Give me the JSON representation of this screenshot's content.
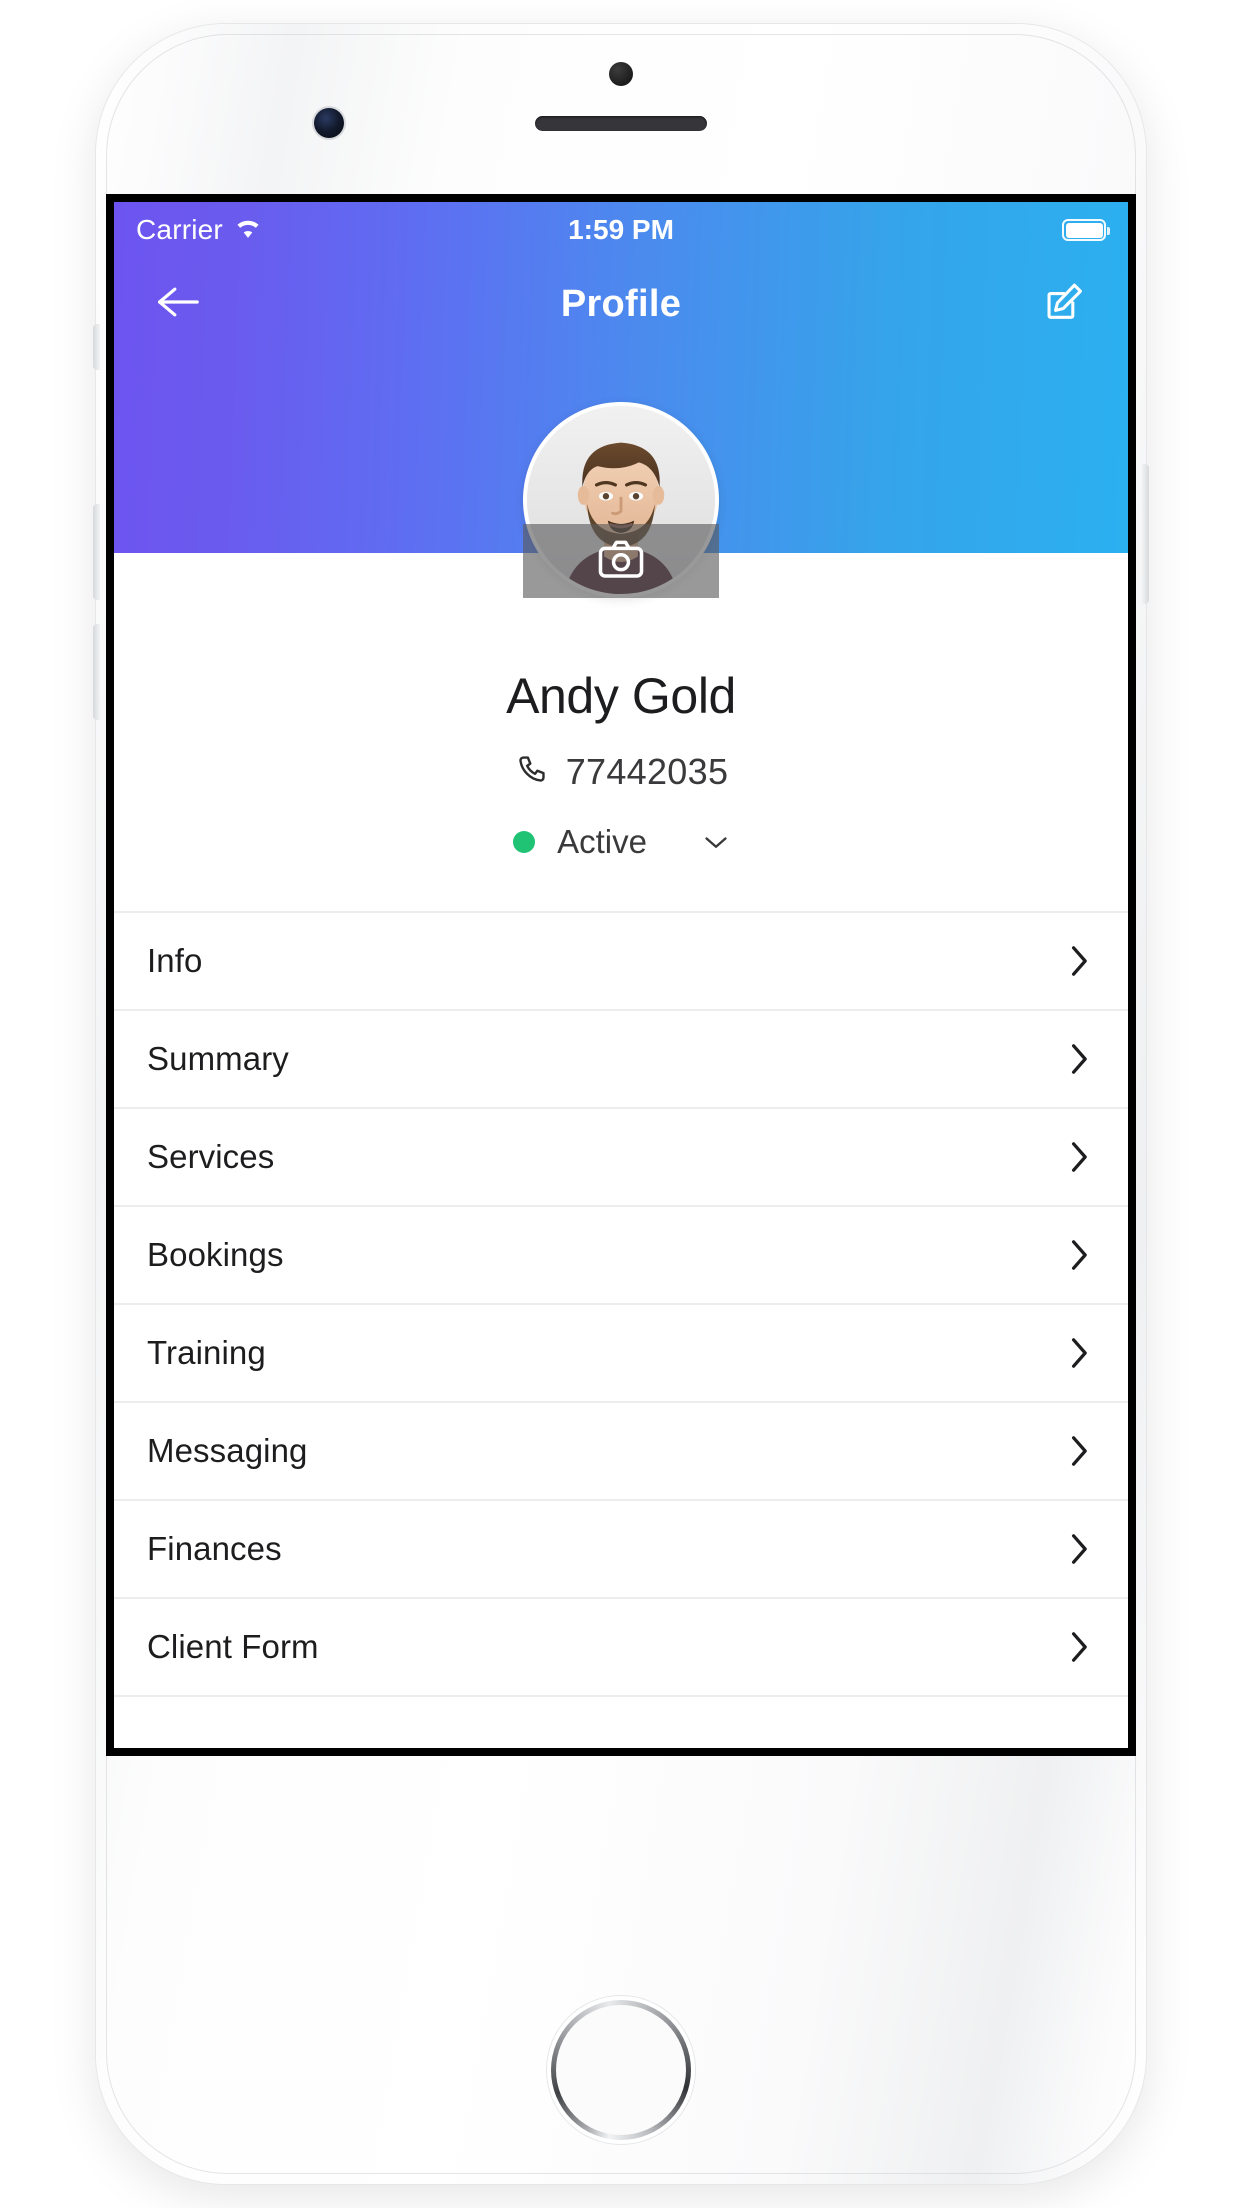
{
  "device": {
    "sensor_icon": "proximity-sensor",
    "camera_icon": "front-camera",
    "earpiece_icon": "earpiece-speaker",
    "home_icon": "home-button"
  },
  "status_bar": {
    "carrier": "Carrier",
    "wifi_icon": "wifi-icon",
    "time": "1:59 PM",
    "battery_icon": "battery-full-icon"
  },
  "nav": {
    "back_icon": "arrow-left-icon",
    "title": "Profile",
    "edit_icon": "edit-pencil-icon"
  },
  "profile": {
    "avatar_icon": "user-avatar-photo",
    "camera_overlay_icon": "camera-icon",
    "name": "Andy Gold",
    "phone_icon": "phone-icon",
    "phone": "77442035",
    "status_label": "Active",
    "status_color": "#20c274",
    "status_caret_icon": "chevron-down-icon"
  },
  "menu": {
    "items": [
      {
        "label": "Info",
        "chevron_icon": "chevron-right-icon"
      },
      {
        "label": "Summary",
        "chevron_icon": "chevron-right-icon"
      },
      {
        "label": "Services",
        "chevron_icon": "chevron-right-icon"
      },
      {
        "label": "Bookings",
        "chevron_icon": "chevron-right-icon"
      },
      {
        "label": "Training",
        "chevron_icon": "chevron-right-icon"
      },
      {
        "label": "Messaging",
        "chevron_icon": "chevron-right-icon"
      },
      {
        "label": "Finances",
        "chevron_icon": "chevron-right-icon"
      },
      {
        "label": "Client Form",
        "chevron_icon": "chevron-right-icon"
      }
    ]
  },
  "theme": {
    "gradient_start": "#6d54f0",
    "gradient_end": "#2bb0f0",
    "text_primary": "#1d1d1f",
    "divider": "#ececee"
  }
}
